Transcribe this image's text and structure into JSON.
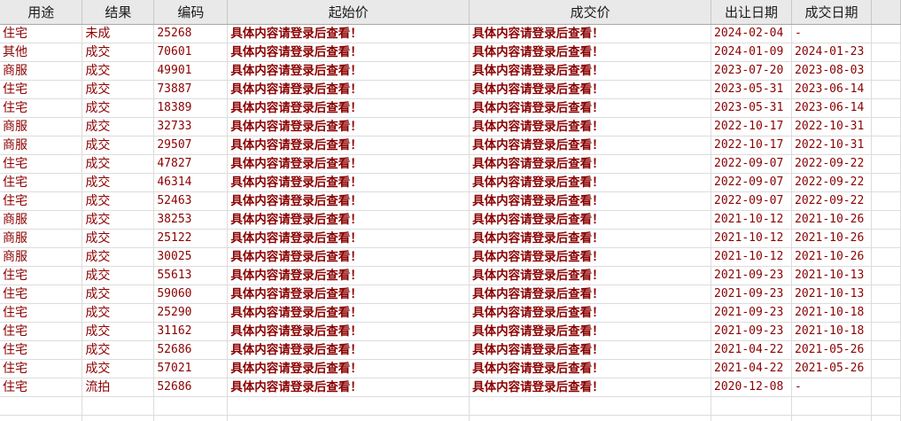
{
  "columns": [
    "用途",
    "结果",
    "编码",
    "起始价",
    "成交价",
    "出让日期",
    "成交日期"
  ],
  "rows": [
    [
      "住宅",
      "未成",
      "25268",
      "具体内容请登录后查看！",
      "具体内容请登录后查看！",
      "2024-02-04",
      "-"
    ],
    [
      "其他",
      "成交",
      "70601",
      "具体内容请登录后查看！",
      "具体内容请登录后查看！",
      "2024-01-09",
      "2024-01-23"
    ],
    [
      "商服",
      "成交",
      "49901",
      "具体内容请登录后查看！",
      "具体内容请登录后查看！",
      "2023-07-20",
      "2023-08-03"
    ],
    [
      "住宅",
      "成交",
      "73887",
      "具体内容请登录后查看！",
      "具体内容请登录后查看！",
      "2023-05-31",
      "2023-06-14"
    ],
    [
      "住宅",
      "成交",
      "18389",
      "具体内容请登录后查看！",
      "具体内容请登录后查看！",
      "2023-05-31",
      "2023-06-14"
    ],
    [
      "商服",
      "成交",
      "32733",
      "具体内容请登录后查看！",
      "具体内容请登录后查看！",
      "2022-10-17",
      "2022-10-31"
    ],
    [
      "商服",
      "成交",
      "29507",
      "具体内容请登录后查看！",
      "具体内容请登录后查看！",
      "2022-10-17",
      "2022-10-31"
    ],
    [
      "住宅",
      "成交",
      "47827",
      "具体内容请登录后查看！",
      "具体内容请登录后查看！",
      "2022-09-07",
      "2022-09-22"
    ],
    [
      "住宅",
      "成交",
      "46314",
      "具体内容请登录后查看！",
      "具体内容请登录后查看！",
      "2022-09-07",
      "2022-09-22"
    ],
    [
      "住宅",
      "成交",
      "52463",
      "具体内容请登录后查看！",
      "具体内容请登录后查看！",
      "2022-09-07",
      "2022-09-22"
    ],
    [
      "商服",
      "成交",
      "38253",
      "具体内容请登录后查看！",
      "具体内容请登录后查看！",
      "2021-10-12",
      "2021-10-26"
    ],
    [
      "商服",
      "成交",
      "25122",
      "具体内容请登录后查看！",
      "具体内容请登录后查看！",
      "2021-10-12",
      "2021-10-26"
    ],
    [
      "商服",
      "成交",
      "30025",
      "具体内容请登录后查看！",
      "具体内容请登录后查看！",
      "2021-10-12",
      "2021-10-26"
    ],
    [
      "住宅",
      "成交",
      "55613",
      "具体内容请登录后查看！",
      "具体内容请登录后查看！",
      "2021-09-23",
      "2021-10-13"
    ],
    [
      "住宅",
      "成交",
      "59060",
      "具体内容请登录后查看！",
      "具体内容请登录后查看！",
      "2021-09-23",
      "2021-10-13"
    ],
    [
      "住宅",
      "成交",
      "25290",
      "具体内容请登录后查看！",
      "具体内容请登录后查看！",
      "2021-09-23",
      "2021-10-18"
    ],
    [
      "住宅",
      "成交",
      "31162",
      "具体内容请登录后查看！",
      "具体内容请登录后查看！",
      "2021-09-23",
      "2021-10-18"
    ],
    [
      "住宅",
      "成交",
      "52686",
      "具体内容请登录后查看！",
      "具体内容请登录后查看！",
      "2021-04-22",
      "2021-05-26"
    ],
    [
      "住宅",
      "成交",
      "57021",
      "具体内容请登录后查看！",
      "具体内容请登录后查看！",
      "2021-04-22",
      "2021-05-26"
    ],
    [
      "住宅",
      "流拍",
      "52686",
      "具体内容请登录后查看！",
      "具体内容请登录后查看！",
      "2020-12-08",
      "-"
    ]
  ],
  "colors": {
    "cell_text": "#8b0000",
    "header_bg": "#e9e9e9",
    "grid": "#dcdcdc"
  }
}
